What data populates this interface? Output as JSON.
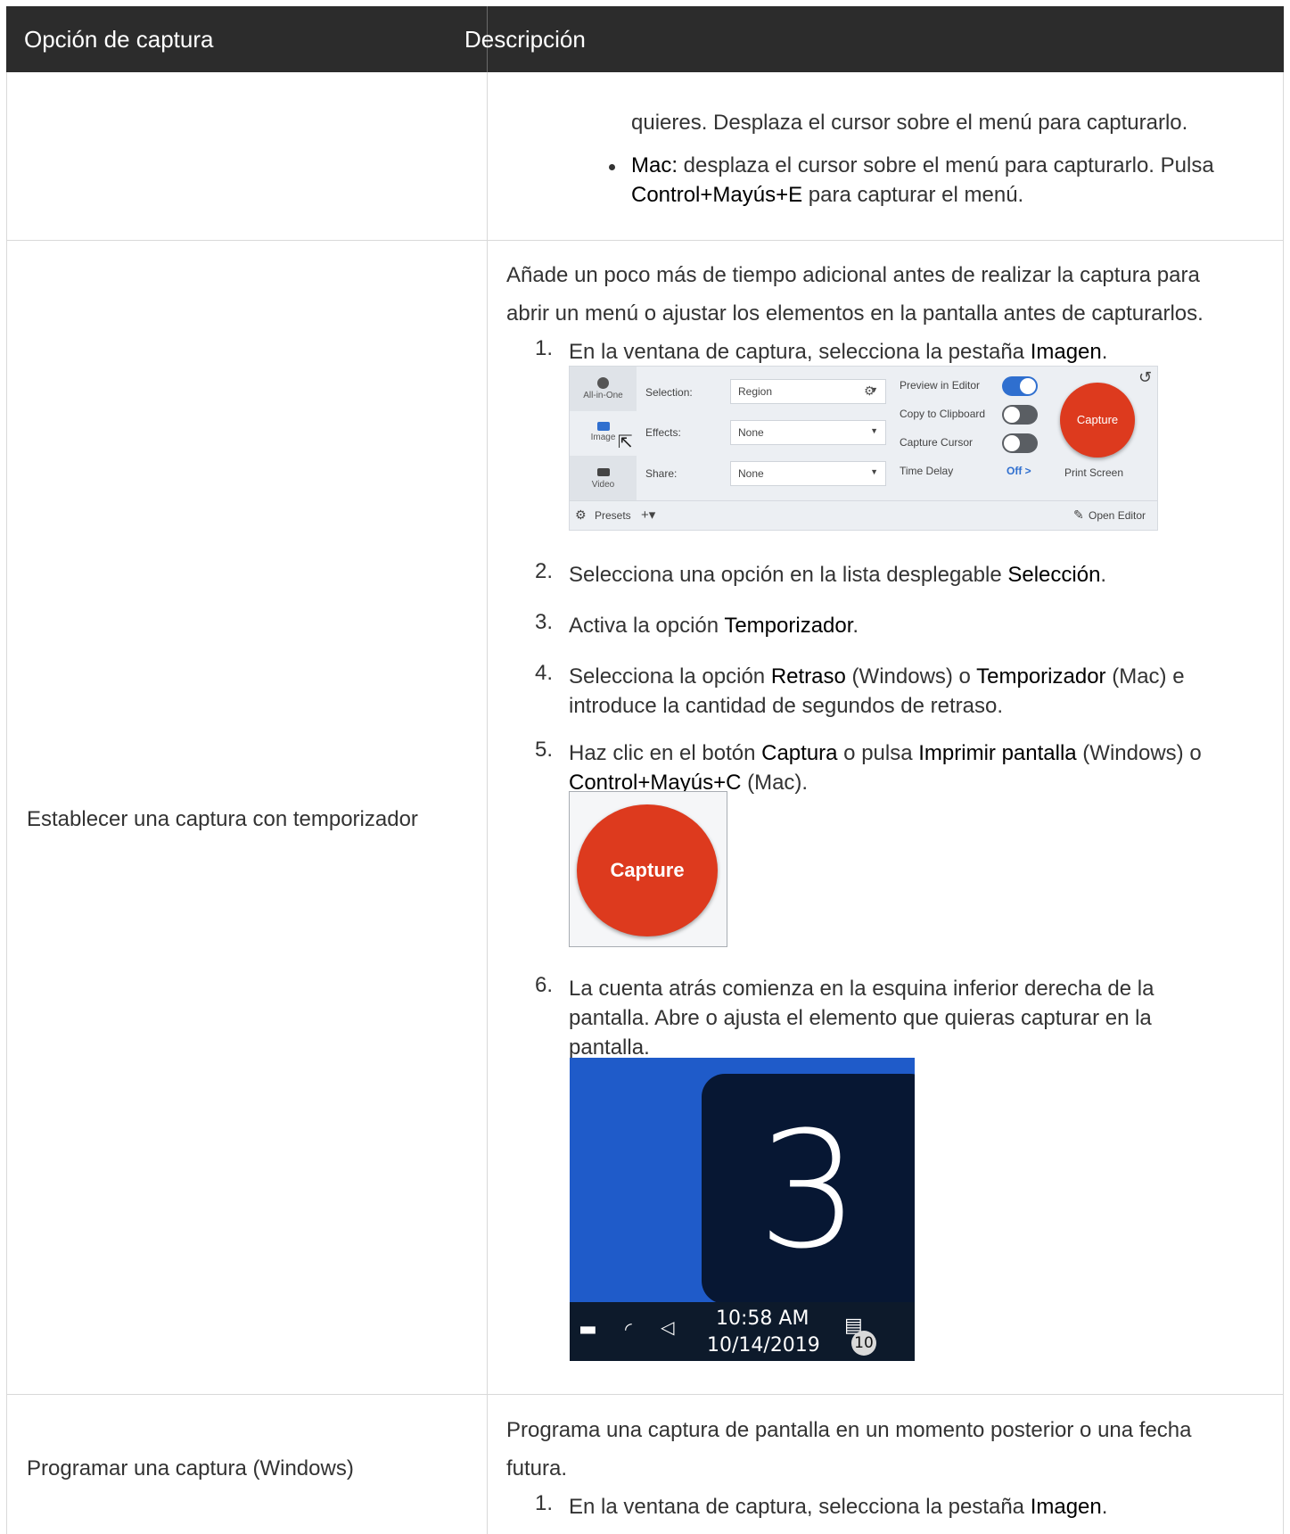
{
  "table": {
    "header": {
      "col1": "Opción de captura",
      "col2": "Descripción"
    },
    "row_menu": {
      "cont_line": "quieres. Desplaza el cursor sobre el menú para capturarlo.",
      "mac_label": "Mac:",
      "mac_text_1": " desplaza el cursor sobre el menú para capturarlo. Pulsa",
      "mac_shortcut": "Control+Mayús+E",
      "mac_text_2": " para capturar el menú."
    },
    "row_timer": {
      "option": "Establecer una captura con temporizador",
      "intro_1": "Añade un poco más de tiempo adicional antes de realizar la captura para",
      "intro_2": "abrir un menú o ajustar los elementos en la pantalla antes de capturarlos.",
      "steps": [
        {
          "num": "1.",
          "pre": "En la ventana de captura, selecciona la pestaña ",
          "bold": "Imagen",
          "post": "."
        },
        {
          "num": "2.",
          "pre": "Selecciona una opción en la lista desplegable ",
          "bold": "Selección",
          "post": "."
        },
        {
          "num": "3.",
          "pre": "Activa la opción ",
          "bold": "Temporizador",
          "post": "."
        },
        {
          "num": "4.",
          "pre": "Selecciona la opción ",
          "bold": "Retraso",
          "mid": " (Windows) o ",
          "bold2": "Temporizador",
          "post": " (Mac) e",
          "line2": "introduce la cantidad de segundos de retraso."
        },
        {
          "num": "5.",
          "pre": "Haz clic en el botón ",
          "bold": "Captura",
          "mid": " o pulsa ",
          "bold2": "Imprimir pantalla",
          "post": " (Windows) o",
          "line2_bold": "Control+Mayús+C",
          "line2": " (Mac)."
        },
        {
          "num": "6.",
          "line1": "La cuenta atrás comienza en la esquina inferior derecha de la",
          "line2": "pantalla. Abre o ajusta el elemento que quieras capturar en la",
          "line3": "pantalla."
        }
      ]
    },
    "row_schedule": {
      "option": "Programar una captura (Windows)",
      "intro_1": "Programa una captura de pantalla en un momento posterior o una fecha",
      "intro_2": "futura.",
      "step1": {
        "num": "1.",
        "pre": "En la ventana de captura, selecciona la pestaña ",
        "bold": "Imagen",
        "post": "."
      }
    }
  },
  "snagit": {
    "tabs": [
      "All-in-One",
      "Image",
      "Video"
    ],
    "selection_label": "Selection:",
    "selection_value": "Region",
    "effects_label": "Effects:",
    "effects_value": "None",
    "share_label": "Share:",
    "share_value": "None",
    "preview_label": "Preview in Editor",
    "clipboard_label": "Copy to Clipboard",
    "cursor_label": "Capture Cursor",
    "delay_label": "Time Delay",
    "delay_value": "Off >",
    "capture_label": "Capture",
    "print_screen": "Print Screen",
    "presets_label": "Presets",
    "open_editor": "Open Editor",
    "accent": "#2f6fcf",
    "capture_color": "#dd3a1e"
  },
  "capture_button": {
    "label": "Capture"
  },
  "countdown": {
    "digit": "3",
    "time": "10:58 AM",
    "date": "10/14/2019",
    "notifications": "10"
  }
}
